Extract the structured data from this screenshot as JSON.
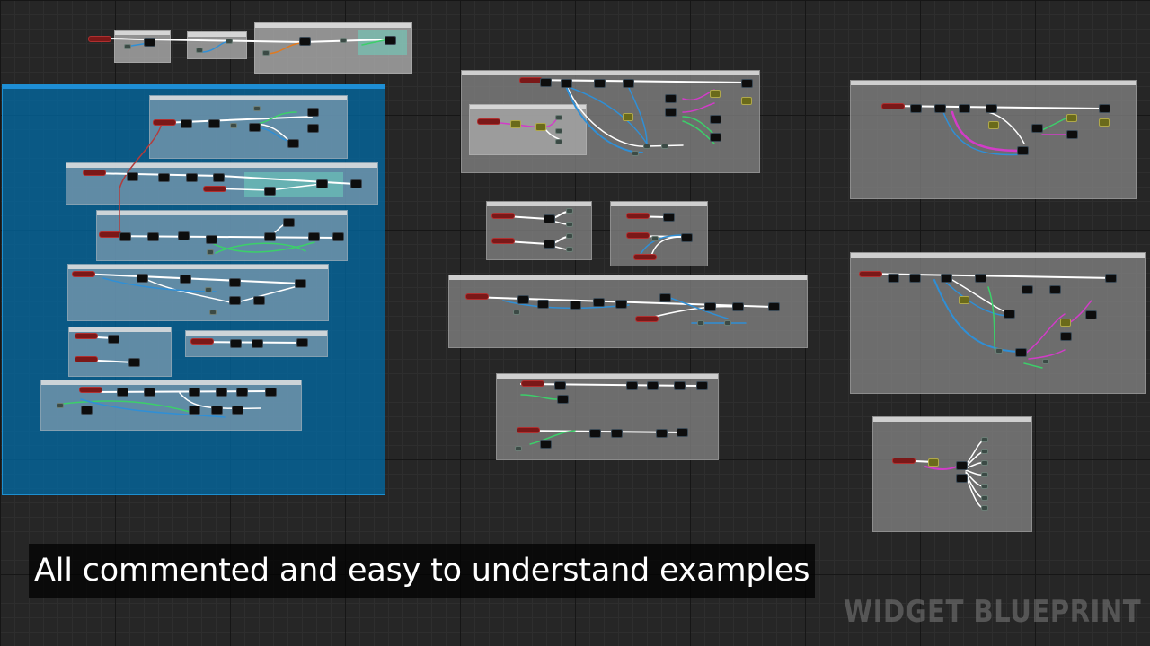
{
  "caption": {
    "text": "All commented and easy to understand examples"
  },
  "watermark": {
    "text": "WIDGET BLUEPRINT"
  },
  "colors": {
    "canvas_background": "#262626",
    "comment_box": "#828282",
    "group_box": "#006eaa",
    "exec_wire": "#ffffff",
    "object_wire": "#2f8fd6",
    "struct_wire": "#3ccf6a",
    "array_wire": "#d23cc8",
    "string_wire": "#e07a20",
    "event_node": "#7b1818"
  },
  "graph": {
    "comments": [
      {
        "id": "top-strip-a",
        "style": "light"
      },
      {
        "id": "top-strip-b",
        "style": "light"
      },
      {
        "id": "top-strip-c",
        "style": "light"
      },
      {
        "id": "blue-group",
        "style": "group"
      },
      {
        "id": "blue-sub-1",
        "style": "on-blue"
      },
      {
        "id": "blue-sub-2",
        "style": "on-blue"
      },
      {
        "id": "blue-sub-3",
        "style": "on-blue"
      },
      {
        "id": "blue-sub-4",
        "style": "on-blue"
      },
      {
        "id": "blue-sub-5",
        "style": "on-blue"
      },
      {
        "id": "blue-sub-6",
        "style": "on-blue"
      },
      {
        "id": "blue-sub-7",
        "style": "on-blue"
      },
      {
        "id": "mid-top",
        "style": "default"
      },
      {
        "id": "mid-inner",
        "style": "light"
      },
      {
        "id": "mid-small-a",
        "style": "default"
      },
      {
        "id": "mid-small-b",
        "style": "default"
      },
      {
        "id": "mid-wide",
        "style": "default"
      },
      {
        "id": "mid-bottom",
        "style": "default"
      },
      {
        "id": "right-top",
        "style": "default"
      },
      {
        "id": "right-middle",
        "style": "default"
      },
      {
        "id": "right-bottom",
        "style": "default"
      }
    ]
  }
}
